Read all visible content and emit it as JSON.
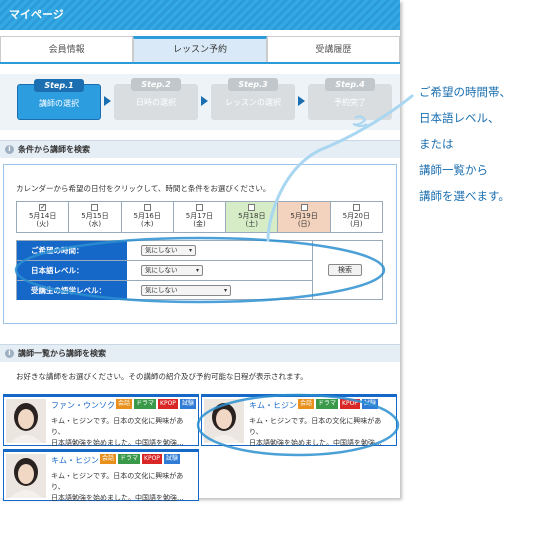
{
  "header": {
    "title": "マイページ"
  },
  "tabs": [
    {
      "label": "会員情報",
      "active": false
    },
    {
      "label": "レッスン予約",
      "active": true
    },
    {
      "label": "受講履歴",
      "active": false
    }
  ],
  "steps": [
    {
      "num": "Step.1",
      "label": "講師の選択",
      "active": true
    },
    {
      "num": "Step.2",
      "label": "日時の選択",
      "active": false
    },
    {
      "num": "Step.3",
      "label": "レッスンの選択",
      "active": false
    },
    {
      "num": "Step.4",
      "label": "予約完了",
      "active": false
    }
  ],
  "filter_section": {
    "title": "条件から講師を検索",
    "instruction": "カレンダーから希望の日付をクリックして、時間と条件をお選びください。"
  },
  "calendar": [
    {
      "date": "5月14日",
      "weekday": "(火)",
      "checked": true,
      "type": "normal"
    },
    {
      "date": "5月15日",
      "weekday": "(水)",
      "checked": false,
      "type": "normal"
    },
    {
      "date": "5月16日",
      "weekday": "(木)",
      "checked": false,
      "type": "normal"
    },
    {
      "date": "5月17日",
      "weekday": "(金)",
      "checked": false,
      "type": "normal"
    },
    {
      "date": "5月18日",
      "weekday": "(土)",
      "checked": false,
      "type": "selected"
    },
    {
      "date": "5月19日",
      "weekday": "(日)",
      "checked": false,
      "type": "sunday"
    },
    {
      "date": "5月20日",
      "weekday": "(月)",
      "checked": false,
      "type": "normal"
    }
  ],
  "conditions": {
    "time_label": "ご希望の時間：",
    "time_value": "気にしない",
    "japanese_label": "日本語レベル：",
    "japanese_value": "気にしない",
    "student_label": "受講生の語学レベル：",
    "student_value": "気にしない",
    "search_label": "検索"
  },
  "list_section": {
    "title": "講師一覧から講師を検索",
    "instruction": "お好きな講師をお選びください。その講師の紹介及び予約可能な日程が表示されます。"
  },
  "tutors": [
    {
      "name": "ファン・ウンソク",
      "desc1": "キム・ヒジンです。日本の文化に興味があり、",
      "desc2": "日本語勉強を始めました。中国語を勉強..."
    },
    {
      "name": "キム・ヒジン",
      "desc1": "キム・ヒジンです。日本の文化に興味があり、",
      "desc2": "日本語勉強を始めました。中国語を勉強..."
    },
    {
      "name": "キム・ヒジン",
      "desc1": "キム・ヒジンです。日本の文化に興味があり、",
      "desc2": "日本語勉強を始めました。中国語を勉強..."
    }
  ],
  "tags": {
    "conv": "会話",
    "drama": "ドラマ",
    "kpop": "KPOP",
    "exam": "試験"
  },
  "annotation": {
    "line1": "ご希望の時間帯、",
    "line2": "日本語レベル、",
    "line3": "または",
    "line4": "講師一覧から",
    "line5": "講師を選べます。"
  },
  "colors": {
    "accent": "#2b9cd9",
    "label_blue": "#1567c8",
    "annotation": "#1b6fb0"
  }
}
